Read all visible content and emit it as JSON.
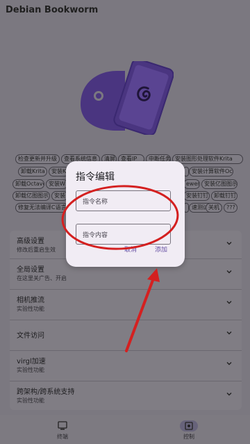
{
  "app_bar": {
    "title": "Debian Bookworm"
  },
  "chips": [
    "检查更新并升级",
    "查看系统信息",
    "清屏",
    "查看IP",
    "中断任务",
    "安装图形处理软件Krita",
    "卸载Krita",
    "安装Ki",
    "",
    "安装计算软件Octave",
    "卸载Octave",
    "安装W",
    "ewer",
    "安装亿图图示",
    "卸载亿图图示",
    "安装",
    "安装钉钉",
    "卸载钉钉",
    "修复无法编译C语言",
    "",
    "速测试",
    "关机",
    "???"
  ],
  "settings": [
    {
      "title": "高级设置",
      "subtitle": "修改后重启生效"
    },
    {
      "title": "全局设置",
      "subtitle": "在这里关广告、开启"
    },
    {
      "title": "相机推流",
      "subtitle": "实验性功能"
    },
    {
      "title": "文件访问",
      "subtitle": ""
    },
    {
      "title": "virgl加速",
      "subtitle": "实验性功能"
    },
    {
      "title": "跨架构/跨系统支持",
      "subtitle": "实验性功能"
    }
  ],
  "bottom_nav": [
    {
      "label": "终端",
      "icon": "terminal-icon"
    },
    {
      "label": "控制",
      "icon": "control-icon"
    }
  ],
  "dialog": {
    "title": "指令编辑",
    "name_placeholder": "指令名称",
    "content_placeholder": "指令内容",
    "cancel_label": "取消",
    "add_label": "添加"
  },
  "colors": {
    "scrim": "#7b7880",
    "dialog_bg": "#f1ecf4",
    "accent": "#6750a4",
    "annotation_red": "#d42020",
    "logo_purple": "#4a3580"
  }
}
